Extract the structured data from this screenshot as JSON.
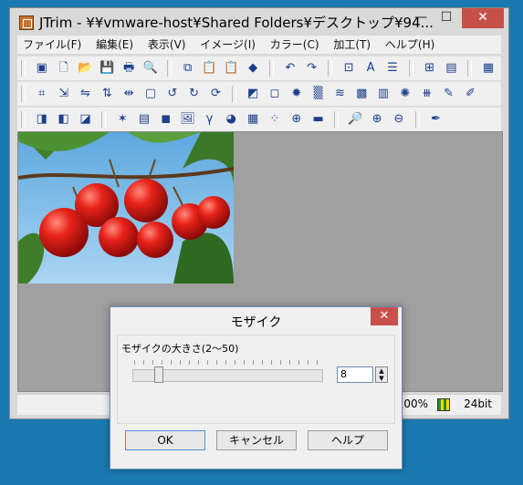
{
  "window": {
    "title": "JTrim - ¥¥vmware-host¥Shared Folders¥デスクトップ¥94...",
    "buttons": {
      "minimize": "—",
      "maximize": "☐",
      "close": "✕"
    }
  },
  "menu": [
    "ファイル(F)",
    "編集(E)",
    "表示(V)",
    "イメージ(I)",
    "カラー(C)",
    "加工(T)",
    "ヘルプ(H)"
  ],
  "toolbar1": [
    "new-icon",
    "new-doc-icon",
    "open-folder-icon",
    "save-icon",
    "print-icon",
    "print-preview-icon",
    "copy-icon",
    "paste-icon",
    "paste-new-icon",
    "paint-fill-icon",
    "undo-icon",
    "redo-icon",
    "fit-icon",
    "text-icon",
    "circle-lines-icon",
    "grid-icon",
    "layout-icon",
    "color-palette-icon"
  ],
  "toolbar2": [
    "crop-icon",
    "resize-icon",
    "flip-h-icon",
    "flip-v-icon",
    "mirror-icon",
    "frame-icon",
    "rotate-left-icon",
    "rotate-right-icon",
    "rotate-icon",
    "shadow-icon",
    "blur-icon",
    "sharpen-icon",
    "noise-icon",
    "wave-icon",
    "mosaic-icon",
    "emboss-icon",
    "edge-icon",
    "spot-icon",
    "pen-icon",
    "eraser-icon",
    "spiral-icon"
  ],
  "toolbar3": [
    "gradient-icon",
    "sepia-icon",
    "contrast-icon",
    "sparkle-icon",
    "rgb-icon",
    "color-icon",
    "picture-icon",
    "gamma-icon",
    "palette-icon",
    "checker-icon",
    "dots-icon",
    "xor-icon",
    "gray-icon",
    "zoom-icon",
    "zoom-in-icon",
    "zoom-out-icon",
    "eyedropper-icon"
  ],
  "status": {
    "zoom": "100%",
    "depth": "24bit"
  },
  "dialog": {
    "title": "モザイク",
    "label": "モザイクの大きさ(2〜50)",
    "value": "8",
    "slider_level": 8,
    "ok": "OK",
    "cancel": "キャンセル",
    "help": "ヘルプ",
    "close": "✕"
  }
}
